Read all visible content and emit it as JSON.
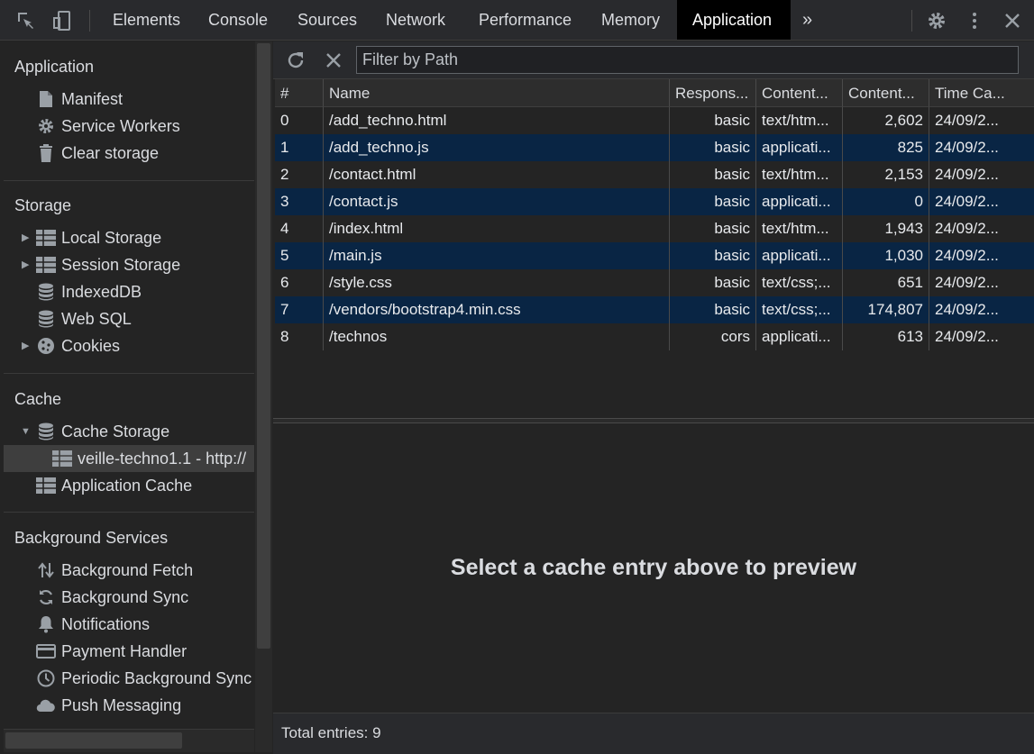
{
  "toolbar": {
    "tabs": [
      {
        "label": "Elements"
      },
      {
        "label": "Console"
      },
      {
        "label": "Sources"
      },
      {
        "label": "Network"
      },
      {
        "label": "Performance"
      },
      {
        "label": "Memory"
      },
      {
        "label": "Application",
        "active": true
      }
    ],
    "more_tabs": "»",
    "icons": [
      "inspect-element-icon",
      "device-toggle-icon",
      "settings-gear-icon",
      "kebab-menu-icon",
      "close-icon"
    ]
  },
  "sidebar": {
    "sections": [
      {
        "title": "Application",
        "items": [
          {
            "label": "Manifest",
            "icon": "document-icon"
          },
          {
            "label": "Service Workers",
            "icon": "gear-icon"
          },
          {
            "label": "Clear storage",
            "icon": "trash-icon"
          }
        ]
      },
      {
        "title": "Storage",
        "items": [
          {
            "label": "Local Storage",
            "icon": "table-icon",
            "expandable": true
          },
          {
            "label": "Session Storage",
            "icon": "table-icon",
            "expandable": true
          },
          {
            "label": "IndexedDB",
            "icon": "database-icon"
          },
          {
            "label": "Web SQL",
            "icon": "database-icon"
          },
          {
            "label": "Cookies",
            "icon": "cookie-icon",
            "expandable": true
          }
        ]
      },
      {
        "title": "Cache",
        "items": [
          {
            "label": "Cache Storage",
            "icon": "database-icon",
            "expanded": true
          },
          {
            "label": "veille-techno1.1 - http://",
            "icon": "table-icon",
            "selected": true,
            "child": true
          },
          {
            "label": "Application Cache",
            "icon": "table-icon"
          }
        ]
      },
      {
        "title": "Background Services",
        "items": [
          {
            "label": "Background Fetch",
            "icon": "up-down-arrows-icon"
          },
          {
            "label": "Background Sync",
            "icon": "sync-icon"
          },
          {
            "label": "Notifications",
            "icon": "bell-icon"
          },
          {
            "label": "Payment Handler",
            "icon": "credit-card-icon"
          },
          {
            "label": "Periodic Background Sync",
            "icon": "clock-icon"
          },
          {
            "label": "Push Messaging",
            "icon": "cloud-icon"
          }
        ]
      }
    ]
  },
  "filter": {
    "placeholder": "Filter by Path"
  },
  "table": {
    "columns": [
      "#",
      "Name",
      "Respons...",
      "Content...",
      "Content...",
      "Time Ca..."
    ],
    "rows": [
      [
        "0",
        "/add_techno.html",
        "basic",
        "text/htm...",
        "2,602",
        "24/09/2..."
      ],
      [
        "1",
        "/add_techno.js",
        "basic",
        "applicati...",
        "825",
        "24/09/2..."
      ],
      [
        "2",
        "/contact.html",
        "basic",
        "text/htm...",
        "2,153",
        "24/09/2..."
      ],
      [
        "3",
        "/contact.js",
        "basic",
        "applicati...",
        "0",
        "24/09/2..."
      ],
      [
        "4",
        "/index.html",
        "basic",
        "text/htm...",
        "1,943",
        "24/09/2..."
      ],
      [
        "5",
        "/main.js",
        "basic",
        "applicati...",
        "1,030",
        "24/09/2..."
      ],
      [
        "6",
        "/style.css",
        "basic",
        "text/css;...",
        "651",
        "24/09/2..."
      ],
      [
        "7",
        "/vendors/bootstrap4.min.css",
        "basic",
        "text/css;...",
        "174,807",
        "24/09/2..."
      ],
      [
        "8",
        "/technos",
        "cors",
        "applicati...",
        "613",
        "24/09/2..."
      ]
    ]
  },
  "preview": {
    "message": "Select a cache entry above to preview"
  },
  "status": {
    "text": "Total entries: 9"
  },
  "colors": {
    "accent_row": "#092544",
    "active_tab_bg": "#000000"
  }
}
